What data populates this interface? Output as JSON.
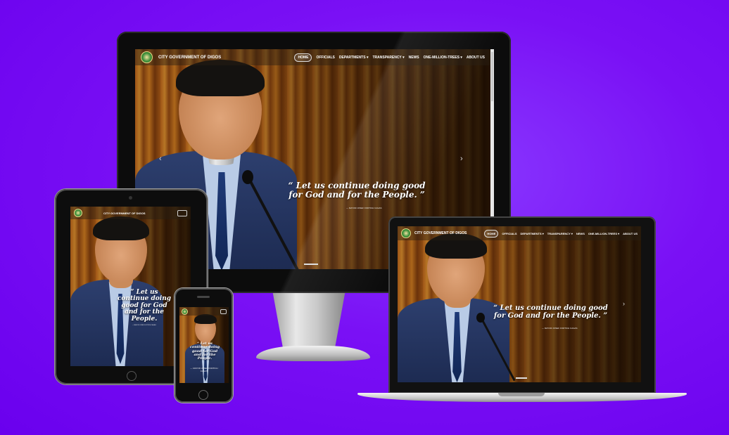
{
  "site": {
    "brand": "CITY GOVERNMENT OF DIGOS",
    "menu": [
      "HOME",
      "OFFICIALS",
      "DEPARTMENTS ▾",
      "TRANSPARENCY ▾",
      "NEWS",
      "ONE-MILLION-TREES ▾",
      "ABOUT US"
    ],
    "quote_line1": "“ Let us continue doing good",
    "quote_line2": "for God and for the People. ”",
    "quote_tablet": "“ Let us continue doing good for God and for the People.",
    "quote_phone": "“ Let us continue doing good for God and for the People.",
    "author": "— MAYOR JOSEF FORTICH CAGAS",
    "author_phone": "— MAYOR JOSEF FORTICH CAGAS"
  },
  "icons": {
    "next": "chevron-right-icon",
    "prev": "chevron-left-icon",
    "menu": "hamburger-icon"
  },
  "colors": {
    "background": "#7a10f5",
    "wood": "#c9781f"
  }
}
